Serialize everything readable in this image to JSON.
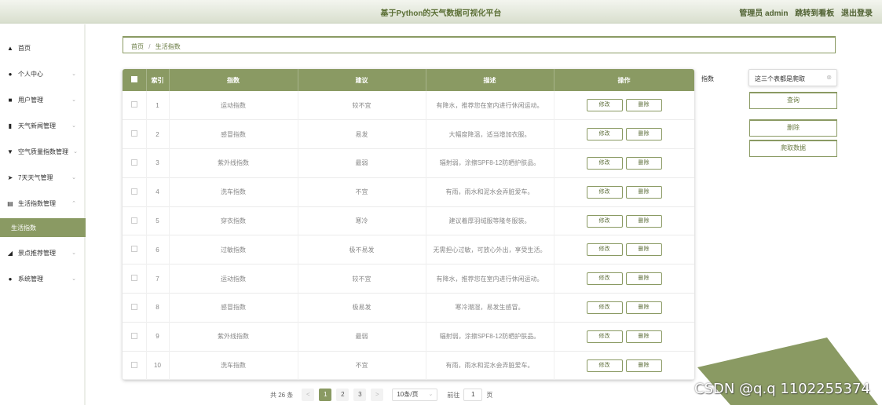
{
  "header": {
    "title": "基于Python的天气数据可视化平台",
    "user": "管理员 admin",
    "dashboard_link": "跳转到看板",
    "logout": "退出登录"
  },
  "sidebar": {
    "items": [
      {
        "label": "首页",
        "icon": "home-icon",
        "glyph": "▲",
        "arrow": ""
      },
      {
        "label": "个人中心",
        "icon": "user-icon",
        "glyph": "●",
        "arrow": "⌄"
      },
      {
        "label": "用户管理",
        "icon": "grid-icon",
        "glyph": "■",
        "arrow": "⌄"
      },
      {
        "label": "天气新闻管理",
        "icon": "bar-chart-icon",
        "glyph": "▮",
        "arrow": "⌄"
      },
      {
        "label": "空气质量指数管理",
        "icon": "filter-icon",
        "glyph": "▼",
        "arrow": "⌄"
      },
      {
        "label": "7天天气管理",
        "icon": "send-icon",
        "glyph": "➤",
        "arrow": "⌄"
      },
      {
        "label": "生活指数管理",
        "icon": "document-icon",
        "glyph": "▤",
        "arrow": "⌃"
      },
      {
        "label": "生活指数",
        "icon": "",
        "glyph": "",
        "arrow": ""
      },
      {
        "label": "景点推荐管理",
        "icon": "thumbs-up-icon",
        "glyph": "◢",
        "arrow": "⌄"
      },
      {
        "label": "系统管理",
        "icon": "user-settings-icon",
        "glyph": "●",
        "arrow": "⌄"
      }
    ]
  },
  "breadcrumb": {
    "home": "首页",
    "separator": "/",
    "current": "生活指数"
  },
  "table": {
    "headers": [
      "索引",
      "指数",
      "建议",
      "描述",
      "操作"
    ],
    "edit_label": "修改",
    "delete_label": "删除",
    "rows": [
      {
        "index": "1",
        "name": "运动指数",
        "advice": "较不宜",
        "desc": "有降水，推荐您在室内进行休闲运动。"
      },
      {
        "index": "2",
        "name": "感冒指数",
        "advice": "易发",
        "desc": "大幅度降温，适当增加衣服。"
      },
      {
        "index": "3",
        "name": "紫外线指数",
        "advice": "最弱",
        "desc": "辐射弱，涂擦SPF8-12防晒护肤品。"
      },
      {
        "index": "4",
        "name": "洗车指数",
        "advice": "不宜",
        "desc": "有雨，雨水和泥水会弄脏爱车。"
      },
      {
        "index": "5",
        "name": "穿衣指数",
        "advice": "寒冷",
        "desc": "建议着厚羽绒服等隆冬服装。"
      },
      {
        "index": "6",
        "name": "过敏指数",
        "advice": "极不易发",
        "desc": "无需担心过敏，可放心外出，享受生活。"
      },
      {
        "index": "7",
        "name": "运动指数",
        "advice": "较不宜",
        "desc": "有降水，推荐您在室内进行休闲运动。"
      },
      {
        "index": "8",
        "name": "感冒指数",
        "advice": "极易发",
        "desc": "寒冷潮湿，易发生感冒。"
      },
      {
        "index": "9",
        "name": "紫外线指数",
        "advice": "最弱",
        "desc": "辐射弱，涂擦SPF8-12防晒护肤品。"
      },
      {
        "index": "10",
        "name": "洗车指数",
        "advice": "不宜",
        "desc": "有雨，雨水和泥水会弄脏爱车。"
      }
    ]
  },
  "search": {
    "label": "指数",
    "value": "这三个表都是爬取",
    "query_button": "查询",
    "delete_button": "删除",
    "crawl_button": "爬取数据"
  },
  "pagination": {
    "total": "共 26 条",
    "prev": "<",
    "next": ">",
    "pages": [
      "1",
      "2",
      "3"
    ],
    "current_page": "1",
    "page_size": "10条/页",
    "goto_label": "前往",
    "goto_value": "1",
    "page_unit": "页"
  },
  "watermark": "CSDN @q.q 1102255374",
  "colors": {
    "accent": "#8a9a63",
    "header_text": "#5b6f35"
  }
}
